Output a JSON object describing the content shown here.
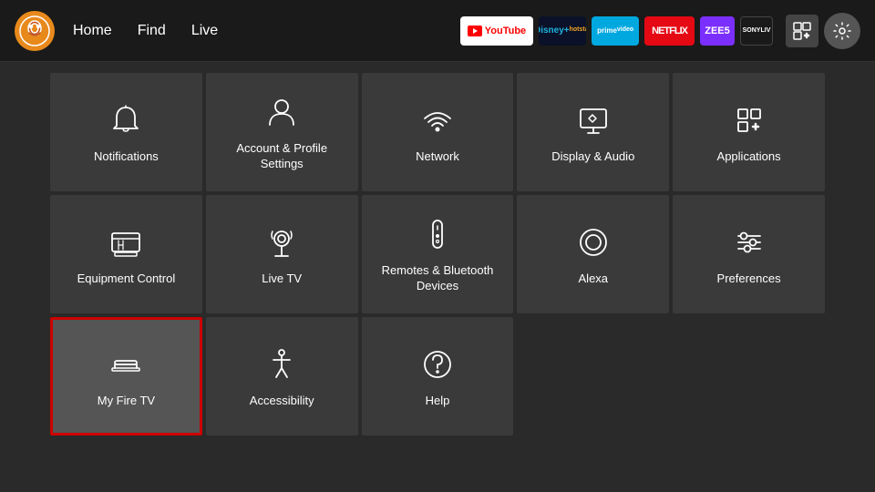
{
  "nav": {
    "links": [
      "Home",
      "Find",
      "Live"
    ],
    "apps": [
      {
        "name": "YouTube",
        "class": "app-youtube",
        "label": "▶ YouTube"
      },
      {
        "name": "Disney+ Hotstar",
        "class": "app-disney",
        "label": "Disney+\nhotstar"
      },
      {
        "name": "Prime Video",
        "class": "app-prime",
        "label": "prime\nvideo"
      },
      {
        "name": "Netflix",
        "class": "app-netflix",
        "label": "NETFLIX"
      },
      {
        "name": "Zee5",
        "class": "app-zee5",
        "label": "ZEE5"
      },
      {
        "name": "SonyLIV",
        "class": "app-sony",
        "label": "SONY\nLIV"
      }
    ]
  },
  "settings": {
    "title": "Settings",
    "tiles": [
      {
        "id": "notifications",
        "label": "Notifications",
        "icon": "bell",
        "selected": false,
        "row": 1
      },
      {
        "id": "account-profile",
        "label": "Account & Profile Settings",
        "icon": "person",
        "selected": false,
        "row": 1
      },
      {
        "id": "network",
        "label": "Network",
        "icon": "wifi",
        "selected": false,
        "row": 1
      },
      {
        "id": "display-audio",
        "label": "Display & Audio",
        "icon": "display",
        "selected": false,
        "row": 1
      },
      {
        "id": "applications",
        "label": "Applications",
        "icon": "apps",
        "selected": false,
        "row": 1
      },
      {
        "id": "equipment-control",
        "label": "Equipment Control",
        "icon": "tv",
        "selected": false,
        "row": 2
      },
      {
        "id": "live-tv",
        "label": "Live TV",
        "icon": "antenna",
        "selected": false,
        "row": 2
      },
      {
        "id": "remotes-bluetooth",
        "label": "Remotes & Bluetooth Devices",
        "icon": "remote",
        "selected": false,
        "row": 2
      },
      {
        "id": "alexa",
        "label": "Alexa",
        "icon": "alexa",
        "selected": false,
        "row": 2
      },
      {
        "id": "preferences",
        "label": "Preferences",
        "icon": "sliders",
        "selected": false,
        "row": 2
      },
      {
        "id": "my-fire-tv",
        "label": "My Fire TV",
        "icon": "firetv",
        "selected": true,
        "row": 3
      },
      {
        "id": "accessibility",
        "label": "Accessibility",
        "icon": "accessibility",
        "selected": false,
        "row": 3
      },
      {
        "id": "help",
        "label": "Help",
        "icon": "help",
        "selected": false,
        "row": 3
      }
    ]
  }
}
